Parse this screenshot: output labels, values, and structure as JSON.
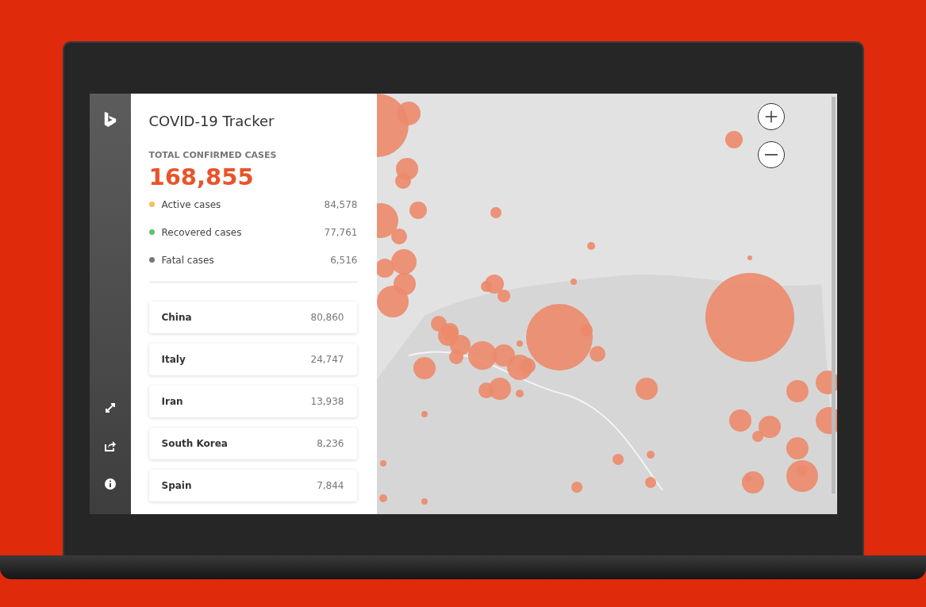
{
  "app": {
    "title": "COVID-19 Tracker"
  },
  "total": {
    "label": "TOTAL CONFIRMED CASES",
    "value": "168,855"
  },
  "stats": [
    {
      "label": "Active cases",
      "value": "84,578",
      "color": "#f2c15a"
    },
    {
      "label": "Recovered cases",
      "value": "77,761",
      "color": "#5cc26e"
    },
    {
      "label": "Fatal cases",
      "value": "6,516",
      "color": "#777777"
    }
  ],
  "countries": [
    {
      "name": "China",
      "value": "80,860"
    },
    {
      "name": "Italy",
      "value": "24,747"
    },
    {
      "name": "Iran",
      "value": "13,938"
    },
    {
      "name": "South Korea",
      "value": "8,236"
    },
    {
      "name": "Spain",
      "value": "7,844"
    }
  ]
}
